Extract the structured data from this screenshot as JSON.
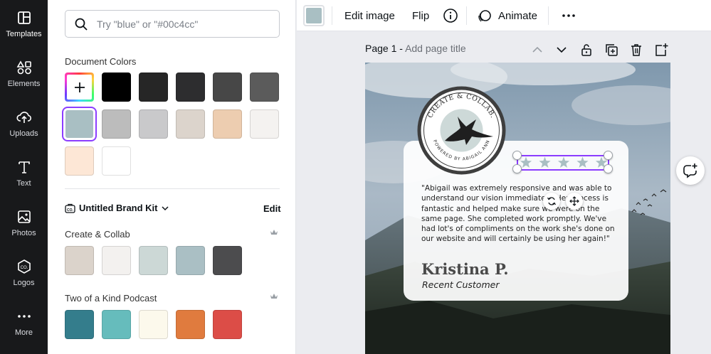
{
  "rail": {
    "items": [
      {
        "label": "Templates",
        "icon": "templates-icon"
      },
      {
        "label": "Elements",
        "icon": "elements-icon"
      },
      {
        "label": "Uploads",
        "icon": "uploads-icon"
      },
      {
        "label": "Text",
        "icon": "text-icon"
      },
      {
        "label": "Photos",
        "icon": "photos-icon"
      },
      {
        "label": "Logos",
        "icon": "logos-icon"
      },
      {
        "label": "More",
        "icon": "more-icon"
      }
    ]
  },
  "panel": {
    "search_placeholder": "Try \"blue\" or \"#00c4cc\"",
    "document_colors_title": "Document Colors",
    "document_colors": [
      "#000000",
      "#262626",
      "#2d2d2f",
      "#474747",
      "#5b5b5b",
      "#a9bfc3",
      "#bcbcbc",
      "#c9c9cb",
      "#dcd4cc",
      "#edcdb0",
      "#f4f2f0",
      "#fde7d6",
      "#ffffff"
    ],
    "brand_kit_label": "Untitled Brand Kit",
    "brand_kit_edit": "Edit",
    "palettes": [
      {
        "name": "Create & Collab",
        "colors": [
          "#dbd3cb",
          "#f3f1ef",
          "#ccd8d6",
          "#aabfc4",
          "#4c4c4e"
        ]
      },
      {
        "name": "Two of a Kind Podcast",
        "colors": [
          "#347d8c",
          "#66bcbc",
          "#fcf9ec",
          "#e07b3e",
          "#dc4d47"
        ]
      }
    ]
  },
  "toolbar": {
    "color_swatch": "#a9bfc3",
    "edit_image": "Edit image",
    "flip": "Flip",
    "animate": "Animate"
  },
  "page": {
    "title_prefix": "Page 1 -",
    "title_placeholder": "Add page title"
  },
  "design": {
    "logo_text_top": "CREATE & COLLAB.",
    "logo_text_bottom": "POWERED BY ABIGAIL ANN",
    "quote": "\"Abigail was extremely responsive and was able to understand our vision immediately. Her process is fantastic and helped make sure we were on the same page. She completed work promptly. We've had lot's of compliments on the work she's done on our website and will certainly be using her again!\"",
    "name": "Kristina P.",
    "role": "Recent Customer",
    "rating": 5,
    "accent": "#8b3dff"
  }
}
